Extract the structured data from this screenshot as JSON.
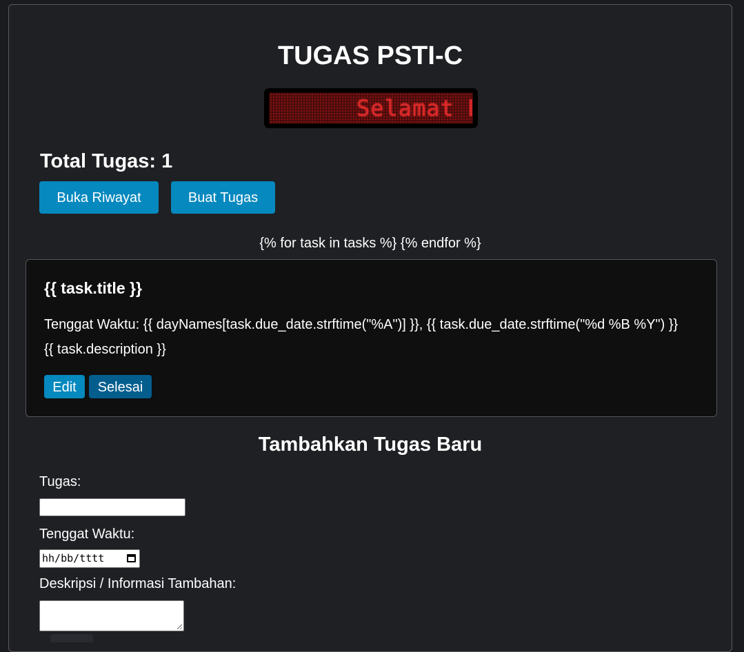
{
  "header": {
    "title": "TUGAS PSTI-C",
    "marquee_text": "Selamat D"
  },
  "summary": {
    "total_label": "Total Tugas: 1"
  },
  "actions": {
    "open_history_label": "Buka Riwayat",
    "create_task_label": "Buat Tugas"
  },
  "template_loop": {
    "text": "{% for task in tasks %} {% endfor %}"
  },
  "task_card": {
    "title": "{{ task.title }}",
    "due": "Tenggat Waktu: {{ dayNames[task.due_date.strftime(\"%A\")] }}, {{ task.due_date.strftime(\"%d %B %Y\") }}",
    "description": "{{ task.description }}",
    "edit_label": "Edit",
    "done_label": "Selesai"
  },
  "form": {
    "title": "Tambahkan Tugas Baru",
    "task_label": "Tugas:",
    "task_value": "",
    "due_label": "Tenggat Waktu:",
    "due_placeholder": "hh/bb/tttt",
    "desc_label": "Deskripsi / Informasi Tambahan:",
    "desc_value": ""
  },
  "colors": {
    "background": "#1f2024",
    "card": "#0f0f10",
    "primary_button": "#0689be",
    "secondary_button": "#035e8e",
    "marquee_led": "#e02a2a"
  }
}
